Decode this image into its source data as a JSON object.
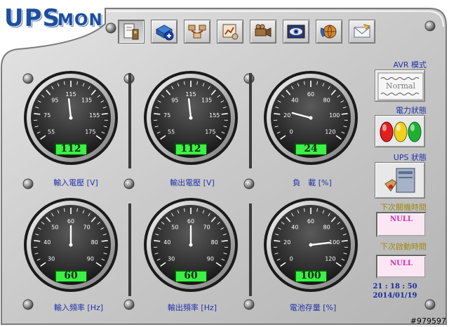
{
  "app": {
    "logo_big": "UPS",
    "logo_small": "MON"
  },
  "toolbar": {
    "buttons": [
      {
        "icon": "settings-document-icon"
      },
      {
        "icon": "database-add-icon"
      },
      {
        "icon": "network-computers-icon"
      },
      {
        "icon": "schedule-chart-icon"
      },
      {
        "icon": "video-camera-icon"
      },
      {
        "icon": "eye-monitor-icon"
      },
      {
        "icon": "globe-phone-icon"
      },
      {
        "icon": "email-envelope-icon"
      }
    ]
  },
  "gauges": [
    {
      "id": "input-voltage",
      "label": "輸入電壓 [V]",
      "min": 55,
      "max": 175,
      "ticks": [
        "55",
        "75",
        "95",
        "115",
        "135",
        "155",
        "175"
      ],
      "value": 112,
      "readout": "112"
    },
    {
      "id": "output-voltage",
      "label": "輸出電壓 [V]",
      "min": 55,
      "max": 175,
      "ticks": [
        "55",
        "75",
        "95",
        "115",
        "135",
        "155",
        "175"
      ],
      "value": 112,
      "readout": "112"
    },
    {
      "id": "load",
      "label": "負　載 [%]",
      "min": 0,
      "max": 120,
      "ticks": [
        "0",
        "20",
        "40",
        "60",
        "80",
        "100",
        "120"
      ],
      "value": 24,
      "readout": "24"
    },
    {
      "id": "input-frequency",
      "label": "輸入頻率 [Hz]",
      "min": 30,
      "max": 90,
      "ticks": [
        "30",
        "40",
        "50",
        "60",
        "70",
        "80",
        "90"
      ],
      "value": 60,
      "readout": "60"
    },
    {
      "id": "output-frequency",
      "label": "輸出頻率 [Hz]",
      "min": 30,
      "max": 90,
      "ticks": [
        "30",
        "40",
        "50",
        "60",
        "70",
        "80",
        "90"
      ],
      "value": 60,
      "readout": "60"
    },
    {
      "id": "battery-capacity",
      "label": "電池存量 [%]",
      "min": 0,
      "max": 120,
      "ticks": [
        "0",
        "20",
        "40",
        "60",
        "80",
        "100",
        "120"
      ],
      "value": 100,
      "readout": "100"
    }
  ],
  "side": {
    "avr_title": "AVR 模式",
    "avr_status": "Normal",
    "power_title": "電力狀態",
    "power_lights": {
      "left": "#e02020",
      "middle": "#f0d020",
      "right": "#20b030"
    },
    "ups_title": "UPS 狀態",
    "shutdown_title": "下次關機時間",
    "shutdown_value": "NULL",
    "startup_title": "下次啟動時間",
    "startup_value": "NULL",
    "time": "21 : 18 : 50",
    "date": "2014/01/19"
  },
  "watermark": "#979597",
  "colors": {
    "panel": "#c8c8c8",
    "label_blue": "#2233a8",
    "readout_green": "#3cf046",
    "null_pink": "#d326b6"
  }
}
